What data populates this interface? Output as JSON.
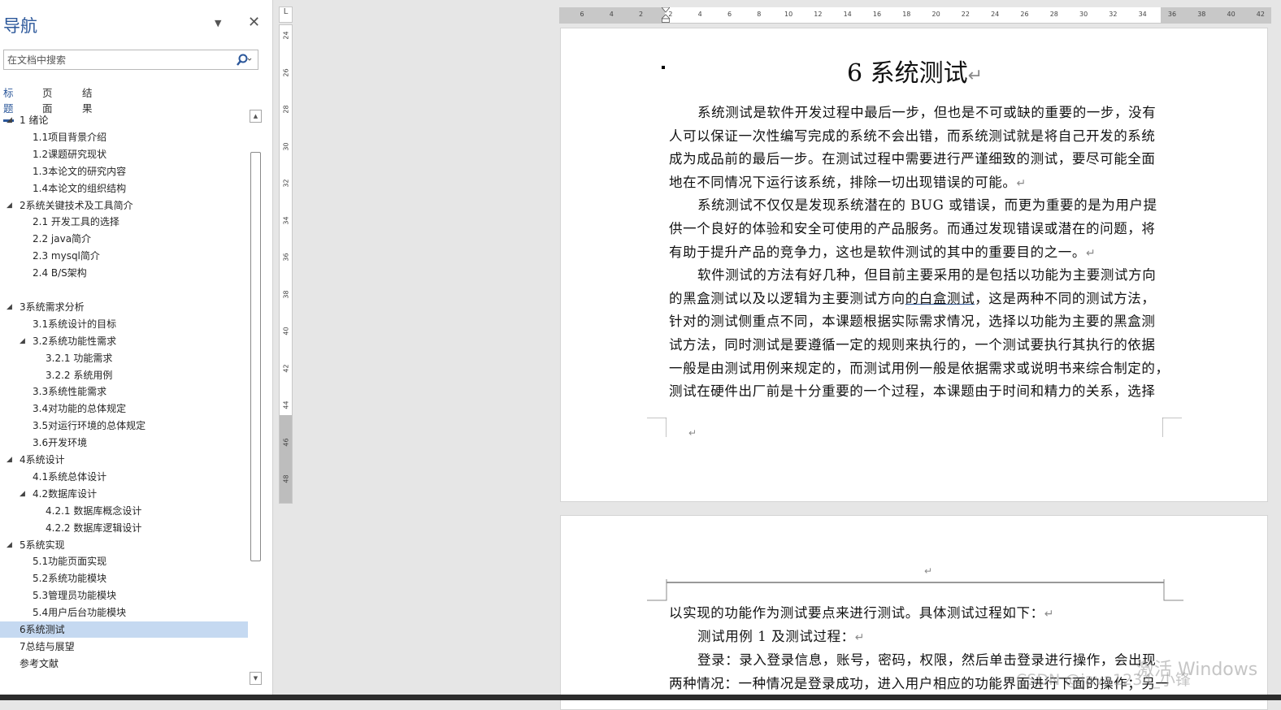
{
  "navigation": {
    "title": "导航",
    "close_glyph": "✕",
    "dropdown_glyph": "▼",
    "search": {
      "placeholder": "在文档中搜索",
      "value": ""
    },
    "tabs": [
      {
        "label": "标题",
        "active": true
      },
      {
        "label": "页面",
        "active": false
      },
      {
        "label": "结果",
        "active": false
      }
    ],
    "outline": [
      {
        "label": "1 绪论",
        "level": 1,
        "expanded": true
      },
      {
        "label": "1.1项目背景介绍",
        "level": 2
      },
      {
        "label": "1.2课题研究现状",
        "level": 2
      },
      {
        "label": "1.3本论文的研究内容",
        "level": 2
      },
      {
        "label": "1.4本论文的组织结构",
        "level": 2
      },
      {
        "label": "2系统关键技术及工具简介",
        "level": 1,
        "expanded": true
      },
      {
        "label": "2.1 开发工具的选择",
        "level": 2
      },
      {
        "label": "2.2 java简介",
        "level": 2
      },
      {
        "label": "2.3 mysql简介",
        "level": 2
      },
      {
        "label": "2.4 B/S架构",
        "level": 2
      },
      {
        "label": "3系统需求分析",
        "level": 1,
        "expanded": true
      },
      {
        "label": "3.1系统设计的目标",
        "level": 2
      },
      {
        "label": "3.2系统功能性需求",
        "level": 2,
        "expanded": true
      },
      {
        "label": "3.2.1 功能需求",
        "level": 3
      },
      {
        "label": "3.2.2 系统用例",
        "level": 3
      },
      {
        "label": "3.3系统性能需求",
        "level": 2
      },
      {
        "label": "3.4对功能的总体规定",
        "level": 2
      },
      {
        "label": "3.5对运行环境的总体规定",
        "level": 2
      },
      {
        "label": "3.6开发环境",
        "level": 2
      },
      {
        "label": "4系统设计",
        "level": 1,
        "expanded": true
      },
      {
        "label": "4.1系统总体设计",
        "level": 2
      },
      {
        "label": "4.2数据库设计",
        "level": 2,
        "expanded": true
      },
      {
        "label": "4.2.1 数据库概念设计",
        "level": 3
      },
      {
        "label": "4.2.2 数据库逻辑设计",
        "level": 3
      },
      {
        "label": "5系统实现",
        "level": 1,
        "expanded": true
      },
      {
        "label": "5.1功能页面实现",
        "level": 2
      },
      {
        "label": "5.2系统功能模块",
        "level": 2
      },
      {
        "label": "5.3管理员功能模块",
        "level": 2
      },
      {
        "label": "5.4用户后台功能模块",
        "level": 2
      },
      {
        "label": "6系统测试",
        "level": 1,
        "selected": true
      },
      {
        "label": "7总结与展望",
        "level": 1
      },
      {
        "label": "参考文献",
        "level": 1
      }
    ]
  },
  "vertical_ruler": {
    "corner": "L",
    "numbers": [
      "24",
      "26",
      "28",
      "30",
      "32",
      "34",
      "36",
      "38",
      "40",
      "42",
      "44",
      "46",
      "48"
    ]
  },
  "horizontal_ruler": {
    "numbers": [
      "6",
      "4",
      "2",
      "2",
      "4",
      "6",
      "8",
      "10",
      "12",
      "14",
      "16",
      "18",
      "20",
      "22",
      "24",
      "26",
      "28",
      "30",
      "32",
      "34",
      "36",
      "38",
      "40",
      "42"
    ]
  },
  "document": {
    "page1": {
      "title": "6 系统测试",
      "title_mark": "↵",
      "lines": [
        {
          "text": "系统测试是软件开发过程中最后一步，但也是不可或缺的重要的一步，没有",
          "indent": true
        },
        {
          "text": "人可以保证一次性编写完成的系统不会出错，而系统测试就是将自己开发的系统"
        },
        {
          "text": "成为成品前的最后一步。在测试过程中需要进行严谨细致的测试，要尽可能全面"
        },
        {
          "text": "地在不同情况下运行该系统，排除一切出现错误的可能。",
          "mark": "↵"
        },
        {
          "text": "系统测试不仅仅是发现系统潜在的 BUG 或错误，而更为重要的是为用户提",
          "indent": true
        },
        {
          "text": "供一个良好的体验和安全可使用的产品服务。而通过发现错误或潜在的问题，将"
        },
        {
          "text": "有助于提升产品的竞争力，这也是软件测试的其中的重要目的之一。",
          "mark": "↵"
        },
        {
          "text": "软件测试的方法有好几种，但目前主要采用的是包括以功能为主要测试方向",
          "indent": true
        },
        {
          "text_before": "的黑盒测试以及以逻辑为主要测试方向",
          "text_underlined": "的白盒测试",
          "text_after": "，这是两种不同的测试方法，",
          "split": true
        },
        {
          "text": "针对的测试侧重点不同，本课题根据实际需求情况，选择以功能为主要的黑盒测"
        },
        {
          "text": "试方法，同时测试是要遵循一定的规则来执行的，一个测试要执行其执行的依据"
        },
        {
          "text": "一般是由测试用例来规定的，而测试用例一般是依据需求或说明书来综合制定的，"
        },
        {
          "text": "测试在硬件出厂前是十分重要的一个过程，本课题由于时间和精力的关系，选择"
        }
      ],
      "footer_mark": "↵"
    },
    "page2": {
      "header_mark": "↵",
      "lines": [
        {
          "text": "以实现的功能作为测试要点来进行测试。具体测试过程如下：",
          "mark": "↵"
        },
        {
          "text": "测试用例 1 及测试过程：",
          "indent": true,
          "mark": "↵"
        },
        {
          "text": "登录：录入登录信息，账号，密码，权限，然后单击登录进行操作，会出现",
          "indent": true
        },
        {
          "text": "两种情况：一种情况是登录成功，进入用户相应的功能界面进行下面的操作；另一"
        }
      ]
    }
  },
  "watermarks": [
    "激活 Windows",
    "CSDN @java1234_小锋"
  ]
}
